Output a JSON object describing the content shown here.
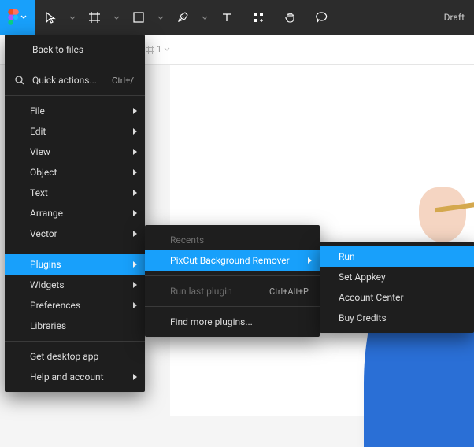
{
  "toolbar": {
    "draft_label": "Draft"
  },
  "canvas_bar": {
    "item": "1"
  },
  "menu": {
    "back": "Back to files",
    "quick": "Quick actions...",
    "quick_shortcut": "Ctrl+/",
    "file": "File",
    "edit": "Edit",
    "view": "View",
    "object": "Object",
    "text": "Text",
    "arrange": "Arrange",
    "vector": "Vector",
    "plugins": "Plugins",
    "widgets": "Widgets",
    "preferences": "Preferences",
    "libraries": "Libraries",
    "desktop": "Get desktop app",
    "help": "Help and account"
  },
  "plugins_menu": {
    "recents": "Recents",
    "pixcut": "PixCut Background Remover",
    "run_last": "Run last plugin",
    "run_last_shortcut": "Ctrl+Alt+P",
    "find_more": "Find more plugins..."
  },
  "plugin_actions": {
    "run": "Run",
    "set_appkey": "Set Appkey",
    "account_center": "Account Center",
    "buy_credits": "Buy Credits"
  }
}
